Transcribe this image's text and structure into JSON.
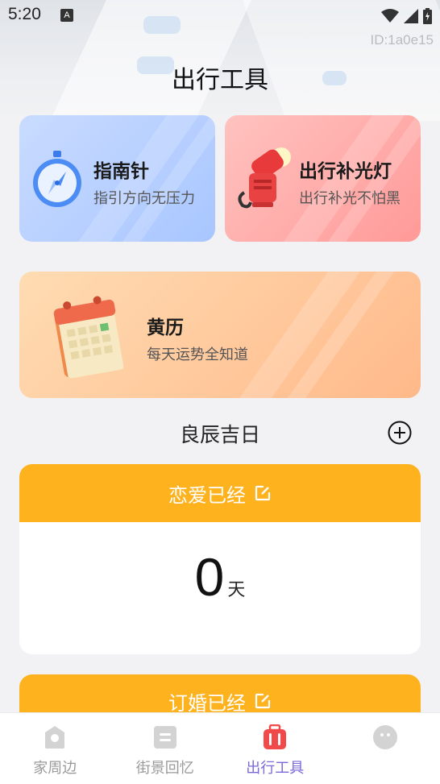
{
  "status_bar": {
    "time": "5:20",
    "notification_letter": "A",
    "device_id": "ID:1a0e15"
  },
  "page": {
    "title": "出行工具"
  },
  "tools": [
    {
      "title": "指南针",
      "subtitle": "指引方向无压力",
      "icon": "compass-icon"
    },
    {
      "title": "出行补光灯",
      "subtitle": "出行补光不怕黑",
      "icon": "fill-light-icon"
    },
    {
      "title": "黄历",
      "subtitle": "每天运势全知道",
      "icon": "calendar-icon"
    }
  ],
  "lucky_days": {
    "title": "良辰吉日",
    "add_icon": "add-circle-icon"
  },
  "counters": [
    {
      "label": "恋爱已经",
      "value": "0",
      "unit": "天",
      "edit_icon": "edit-icon"
    },
    {
      "label": "订婚已经",
      "edit_icon": "edit-icon"
    }
  ],
  "tabbar": [
    {
      "label": "家周边",
      "icon": "location-icon",
      "active": false
    },
    {
      "label": "街景回忆",
      "icon": "note-icon",
      "active": false
    },
    {
      "label": "出行工具",
      "icon": "suitcase-icon",
      "active": true
    },
    {
      "label": "",
      "icon": "avatar-icon",
      "active": false
    }
  ],
  "colors": {
    "accent": "#fdb21e",
    "active_tab": "#7a6ad8",
    "tab_icon_gray": "#d0d0d0",
    "suitcase_red": "#f04a4a"
  }
}
